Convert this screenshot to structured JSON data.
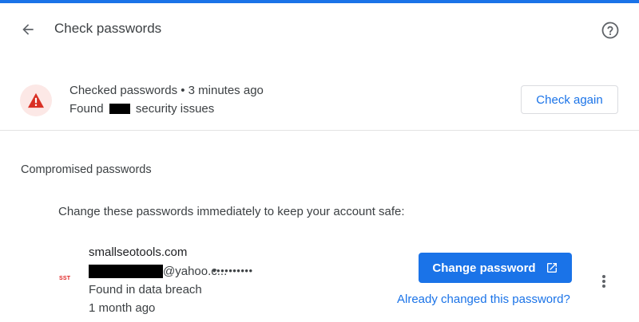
{
  "header": {
    "title": "Check passwords",
    "back_icon": "arrow-left",
    "help_icon": "question-circle"
  },
  "status": {
    "line1": "Checked passwords • 3 minutes ago",
    "line2_prefix": "Found",
    "line2_suffix": "security issues",
    "warning_icon": "warning-triangle",
    "check_again_label": "Check again"
  },
  "compromised": {
    "section_title": "Compromised passwords",
    "description": "Change these passwords immediately to keep your account safe:",
    "entry": {
      "favicon_text": "SST",
      "site": "smallseotools.com",
      "username_suffix": "@yahoo.c...",
      "password_mask": "••••••••••",
      "reason": "Found in data breach",
      "time": "1 month ago",
      "change_button_label": "Change password",
      "already_changed_link": "Already changed this password?"
    }
  },
  "colors": {
    "accent": "#1a73e8",
    "warning": "#d93025",
    "warning_bg": "#fce8e6"
  }
}
